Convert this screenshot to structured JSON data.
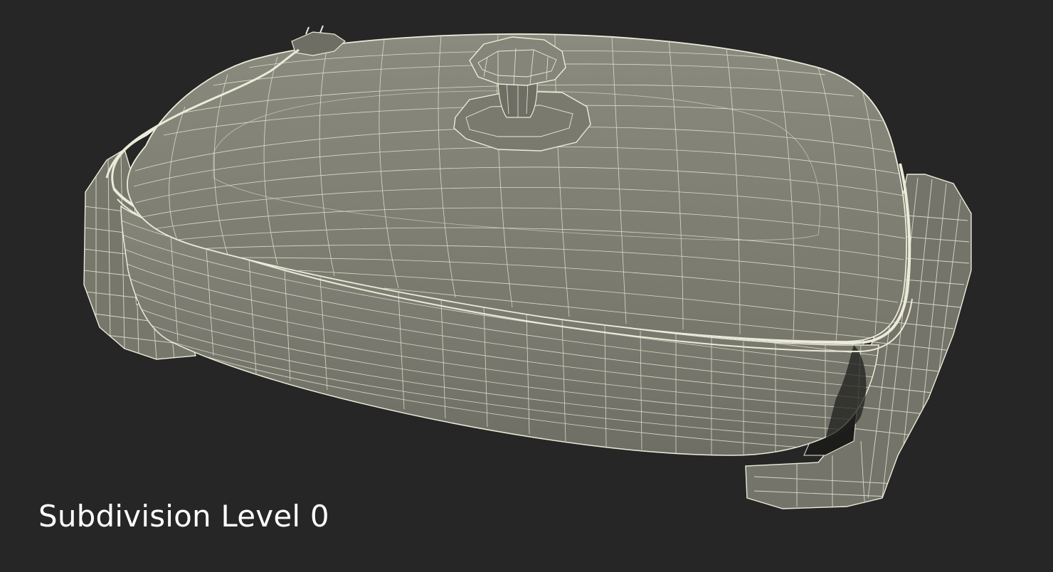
{
  "caption": "Subdivision Level 0",
  "colors": {
    "background": "#262626",
    "mesh_fill": "#7f7f74",
    "mesh_fill_dark": "#5e5e55",
    "mesh_shadow": "#3f3f39",
    "wire": "#ecebd9",
    "caption_text": "#ffffff"
  },
  "model": {
    "name": "electric-skillet",
    "render_style": "wireframe"
  }
}
